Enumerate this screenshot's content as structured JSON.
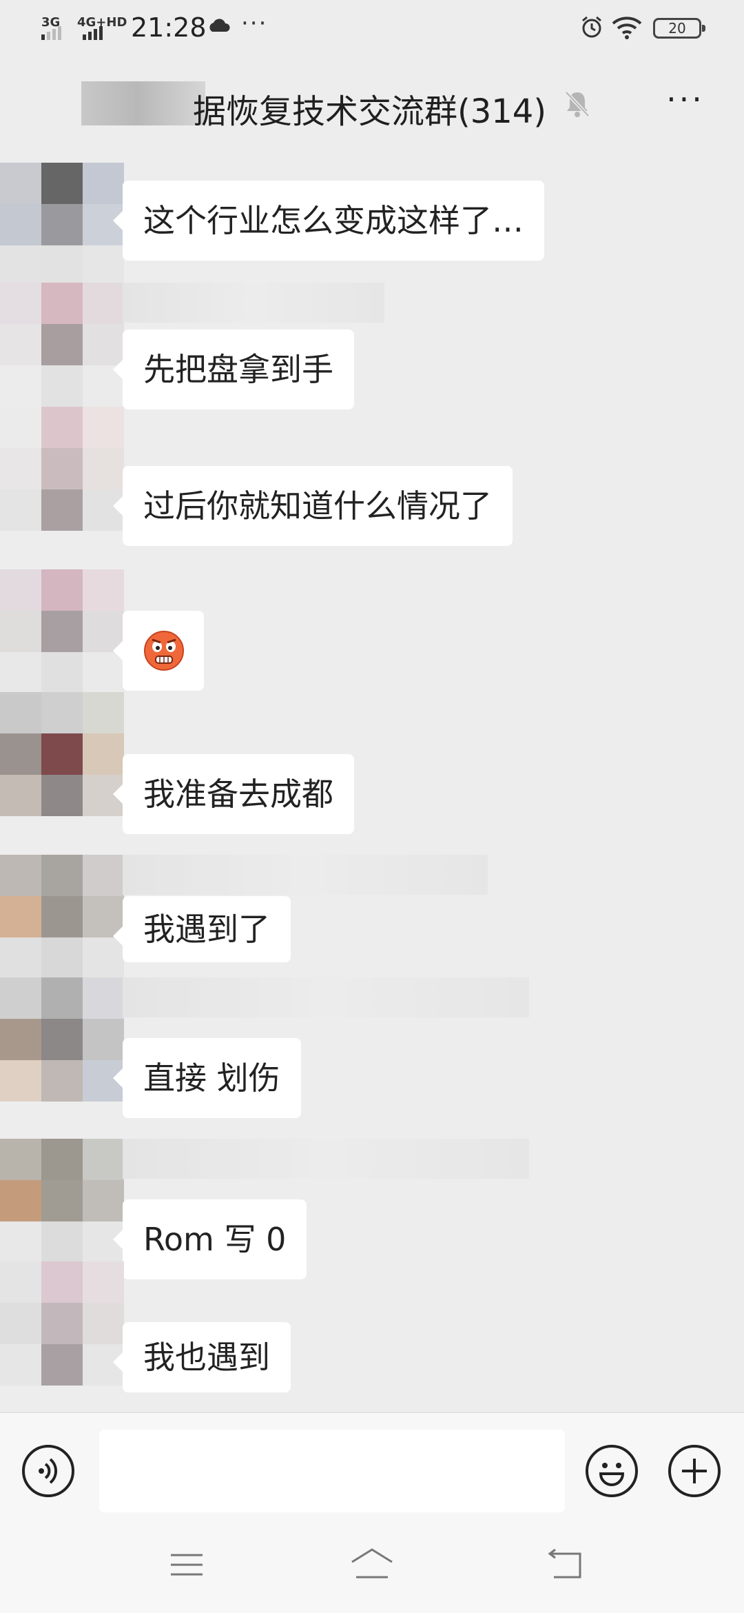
{
  "status_bar": {
    "network1": "3G",
    "network2": "4G+HD",
    "time": "21:28",
    "more": "···",
    "battery": "20",
    "icons": [
      "cloud-icon",
      "alarm-icon",
      "wifi-icon",
      "battery-icon"
    ]
  },
  "header": {
    "title": "据恢复技术交流群(314)",
    "more": "···",
    "icons": [
      "mute-icon",
      "more-icon"
    ]
  },
  "messages": [
    {
      "type": "text",
      "text": "这个行业怎么变成这样了…"
    },
    {
      "type": "text",
      "text": "先把盘拿到手"
    },
    {
      "type": "text",
      "text": "过后你就知道什么情况了"
    },
    {
      "type": "emoji",
      "emoji": "frown-emoji"
    },
    {
      "type": "text",
      "text": "我准备去成都"
    },
    {
      "type": "text",
      "text": "我遇到了"
    },
    {
      "type": "text",
      "text": "直接 划伤"
    },
    {
      "type": "text",
      "text": "Rom 写 0"
    },
    {
      "type": "text",
      "text": "我也遇到"
    }
  ],
  "input_bar": {
    "placeholder": "",
    "icons": [
      "voice-icon",
      "emoji-icon",
      "plus-icon"
    ]
  },
  "nav_bar": {
    "icons": [
      "menu-icon",
      "home-icon",
      "back-icon"
    ]
  },
  "colors": {
    "background": "#ededed",
    "bubble": "#ffffff",
    "text": "#222222"
  }
}
